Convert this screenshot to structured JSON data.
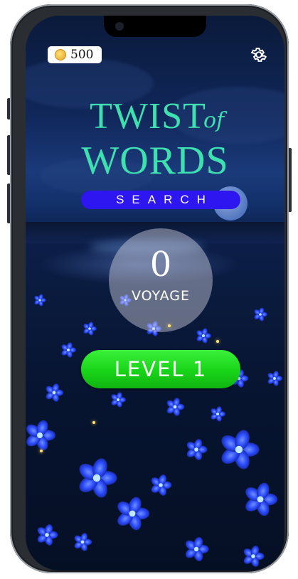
{
  "app": {
    "title_line1": "TWIST",
    "title_of": "of",
    "title_line2": "WORDS"
  },
  "header": {
    "coins": "500",
    "coin_icon": "coin-icon",
    "settings_icon": "gear-icon"
  },
  "search": {
    "label": "SEARCH"
  },
  "voyage": {
    "count": "0",
    "label": "VOYAGE"
  },
  "level_button": {
    "label": "LEVEL 1"
  },
  "colors": {
    "title": "#3fe0b0",
    "search_pill": "#2d16f0",
    "level_button": "#18d418",
    "flower": "#2c4cff"
  }
}
